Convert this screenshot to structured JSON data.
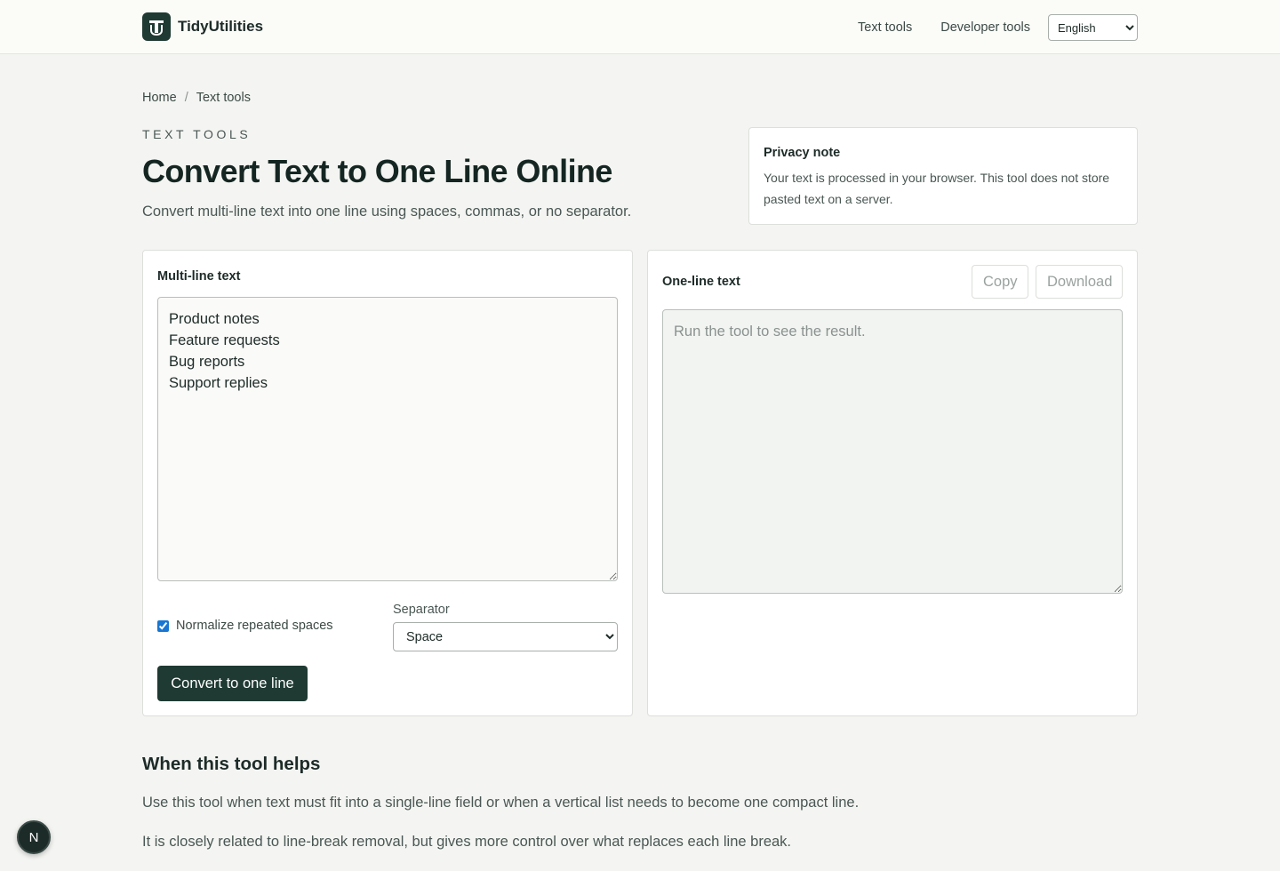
{
  "header": {
    "brand_name": "TidyUtilities",
    "nav": [
      "Text tools",
      "Developer tools"
    ],
    "language": "English"
  },
  "breadcrumb": {
    "home": "Home",
    "separator": "/",
    "current": "Text tools"
  },
  "hero": {
    "eyebrow": "TEXT TOOLS",
    "title": "Convert Text to One Line Online",
    "subtitle": "Convert multi-line text into one line using spaces, commas, or no separator."
  },
  "privacy": {
    "title": "Privacy note",
    "body": "Your text is processed in your browser. This tool does not store pasted text on a server."
  },
  "input_panel": {
    "label": "Multi-line text",
    "value": "Product notes\nFeature requests\nBug reports\nSupport replies",
    "normalize_label": "Normalize repeated spaces",
    "normalize_checked": true,
    "separator_label": "Separator",
    "separator_value": "Space",
    "convert_label": "Convert to one line"
  },
  "output_panel": {
    "label": "One-line text",
    "copy_label": "Copy",
    "download_label": "Download",
    "placeholder": "Run the tool to see the result."
  },
  "info": {
    "title": "When this tool helps",
    "paragraphs": [
      "Use this tool when text must fit into a single-line field or when a vertical list needs to become one compact line.",
      "It is closely related to line-break removal, but gives more control over what replaces each line break."
    ]
  },
  "fab": {
    "letter": "N",
    "icon": "next-badge-icon"
  },
  "colors": {
    "brand": "#1f3a33",
    "background": "#f4f5f2",
    "text": "#1d2b28"
  }
}
